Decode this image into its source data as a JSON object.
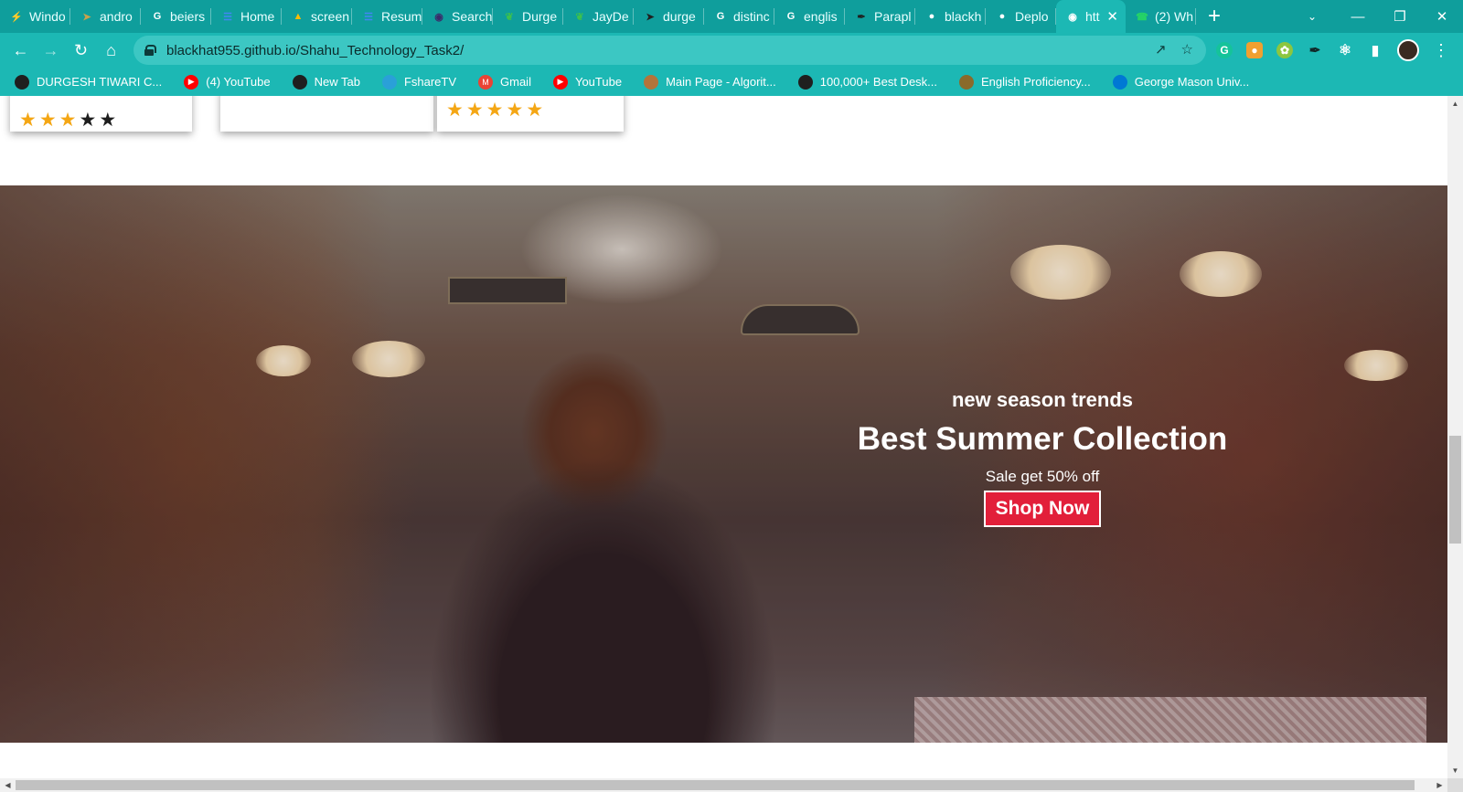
{
  "browser": {
    "tabs": [
      {
        "label": "Windo",
        "icon": "windows-app-icon",
        "color": "#4fa3ff"
      },
      {
        "label": "andro",
        "icon": "android-app-icon",
        "color": "#c9a24a"
      },
      {
        "label": "beiers",
        "icon": "google-icon",
        "color": "#ffffff"
      },
      {
        "label": "Home",
        "icon": "docs-icon",
        "color": "#4285f4"
      },
      {
        "label": "screen",
        "icon": "drive-icon",
        "color": "#fbbc04"
      },
      {
        "label": "Resum",
        "icon": "docs-icon",
        "color": "#4285f4"
      },
      {
        "label": "Search",
        "icon": "search-app-icon",
        "color": "#3b2a6a"
      },
      {
        "label": "Durge",
        "icon": "leaf-icon",
        "color": "#3ec14c"
      },
      {
        "label": "JayDe",
        "icon": "leaf-icon",
        "color": "#3ec14c"
      },
      {
        "label": "durge",
        "icon": "rocket-icon",
        "color": "#1f1f1f"
      },
      {
        "label": "distinc",
        "icon": "google-icon",
        "color": "#ffffff"
      },
      {
        "label": "englis",
        "icon": "google-icon",
        "color": "#ffffff"
      },
      {
        "label": "Parapl",
        "icon": "feather-icon",
        "color": "#1f1f1f"
      },
      {
        "label": "blackh",
        "icon": "github-icon",
        "color": "#ffffff"
      },
      {
        "label": "Deplo",
        "icon": "github-icon",
        "color": "#ffffff"
      },
      {
        "label": "htt",
        "icon": "globe-icon",
        "color": "#ffffff",
        "active": true
      },
      {
        "label": "(2) Wh",
        "icon": "whatsapp-icon",
        "color": "#25d366"
      }
    ],
    "url": "blackhat955.github.io/Shahu_Technology_Task2/",
    "bookmarks": [
      {
        "label": "DURGESH TIWARI C...",
        "icon": "globe-icon"
      },
      {
        "label": "(4) YouTube",
        "icon": "youtube-icon"
      },
      {
        "label": "New Tab",
        "icon": "globe-icon"
      },
      {
        "label": "FshareTV",
        "icon": "fsharetv-icon"
      },
      {
        "label": "Gmail",
        "icon": "gmail-icon"
      },
      {
        "label": "YouTube",
        "icon": "youtube-icon"
      },
      {
        "label": "Main Page - Algorit...",
        "icon": "algorithm-icon"
      },
      {
        "label": "100,000+ Best Desk...",
        "icon": "globe-icon"
      },
      {
        "label": "English Proficiency...",
        "icon": "dictionary-icon"
      },
      {
        "label": "George Mason Univ...",
        "icon": "cloud-icon"
      }
    ]
  },
  "page": {
    "product_cards": [
      {
        "rating": 3
      },
      {
        "rating": null
      },
      {
        "rating": 5
      }
    ],
    "hero": {
      "eyebrow": "new season trends",
      "headline": "Best Summer Collection",
      "sale_text": "Sale get 50% off",
      "cta_label": "Shop Now"
    }
  },
  "colors": {
    "chrome_tabstrip": "#0f9e9c",
    "chrome_toolbar": "#1cb8b4",
    "cta_background": "#e21f3a",
    "star_filled": "#f4a614",
    "star_empty": "#1e1e1e"
  }
}
